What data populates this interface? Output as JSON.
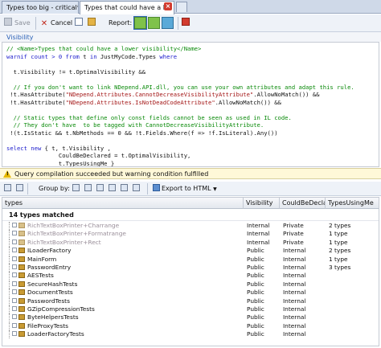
{
  "tabs": [
    {
      "label": "Types too big - critical*",
      "active": false
    },
    {
      "label": "Types that could have a l...",
      "active": true
    }
  ],
  "toolbar": {
    "save_label": "Save",
    "cancel_label": "Cancel",
    "report_label": "Report:"
  },
  "query_name": "Visibility",
  "code_lines": [
    [
      {
        "t": "// <Name>Types that could have a lower visibility</Name>",
        "k": "cm"
      }
    ],
    [
      {
        "t": "warnif count > 0 ",
        "k": "kw"
      },
      {
        "t": "from",
        "k": "kw"
      },
      {
        "t": " t ",
        "k": "tx"
      },
      {
        "t": "in",
        "k": "kw"
      },
      {
        "t": " JustMyCode.Types ",
        "k": "tx"
      },
      {
        "t": "where",
        "k": "kw"
      }
    ],
    [
      {
        "t": "",
        "k": "tx"
      }
    ],
    [
      {
        "t": "  t.Visibility != t.OptimalVisibility &&",
        "k": "tx"
      }
    ],
    [
      {
        "t": "",
        "k": "tx"
      }
    ],
    [
      {
        "t": "  // If you don't want to link NDepend.API.dll, you can use your own attributes and adapt this rule.",
        "k": "cm"
      }
    ],
    [
      {
        "t": " !t.HasAttribute(",
        "k": "tx"
      },
      {
        "t": "\"NDepend.Attributes.CannotDecreaseVisibilityAttribute\"",
        "k": "st"
      },
      {
        "t": ".AllowNoMatch()) &&",
        "k": "tx"
      }
    ],
    [
      {
        "t": " !t.HasAttribute(",
        "k": "tx"
      },
      {
        "t": "\"NDepend.Attributes.IsNotDeadCodeAttribute\"",
        "k": "st"
      },
      {
        "t": ".AllowNoMatch()) &&",
        "k": "tx"
      }
    ],
    [
      {
        "t": "",
        "k": "tx"
      }
    ],
    [
      {
        "t": "  // Static types that define only const fields cannot be seen as used in IL code.",
        "k": "cm"
      }
    ],
    [
      {
        "t": "  // They don't have  to be tagged with CannotDecreaseVisibilityAttribute.",
        "k": "cm"
      }
    ],
    [
      {
        "t": " !(t.IsStatic && t.NbMethods == 0 && !t.Fields.Where(f => !f.IsLiteral).Any())",
        "k": "tx"
      }
    ],
    [
      {
        "t": "",
        "k": "tx"
      }
    ],
    [
      {
        "t": "select new",
        "k": "kw"
      },
      {
        "t": " { t, t.Visibility ,",
        "k": "tx"
      }
    ],
    [
      {
        "t": "               CouldBeDeclared = t.OptimalVisibility,",
        "k": "tx"
      }
    ],
    [
      {
        "t": "               t.TypesUsingMe }",
        "k": "tx"
      }
    ]
  ],
  "status_message": "Query compilation succeeded but warning condition fulfilled",
  "results_toolbar": {
    "group_by_label": "Group by:",
    "export_label": "Export to HTML",
    "export_arrow": "▼"
  },
  "grid": {
    "columns": [
      "types",
      "Visibility",
      "CouldBeDeclarec",
      "TypesUsingMe"
    ],
    "group_label": "14 types matched",
    "rows": [
      {
        "name": "RichTextBoxPrinter+Charrange",
        "visibility": "Internal",
        "could": "Private",
        "using": "2 types",
        "dim": true
      },
      {
        "name": "RichTextBoxPrinter+Formatrange",
        "visibility": "Internal",
        "could": "Private",
        "using": "1 type",
        "dim": true
      },
      {
        "name": "RichTextBoxPrinter+Rect",
        "visibility": "Internal",
        "could": "Private",
        "using": "1 type",
        "dim": true
      },
      {
        "name": "ILoaderFactory",
        "visibility": "Public",
        "could": "Internal",
        "using": "2 types",
        "dim": false
      },
      {
        "name": "MainForm",
        "visibility": "Public",
        "could": "Internal",
        "using": "1 type",
        "dim": false
      },
      {
        "name": "PasswordEntry",
        "visibility": "Public",
        "could": "Internal",
        "using": "3 types",
        "dim": false
      },
      {
        "name": "AESTests",
        "visibility": "Public",
        "could": "Internal",
        "using": "",
        "dim": false
      },
      {
        "name": "SecureHashTests",
        "visibility": "Public",
        "could": "Internal",
        "using": "",
        "dim": false
      },
      {
        "name": "DocumentTests",
        "visibility": "Public",
        "could": "Internal",
        "using": "",
        "dim": false
      },
      {
        "name": "PasswordTests",
        "visibility": "Public",
        "could": "Internal",
        "using": "",
        "dim": false
      },
      {
        "name": "GZipCompressionTests",
        "visibility": "Public",
        "could": "Internal",
        "using": "",
        "dim": false
      },
      {
        "name": "ByteHelpersTests",
        "visibility": "Public",
        "could": "Internal",
        "using": "",
        "dim": false
      },
      {
        "name": "FileProxyTests",
        "visibility": "Public",
        "could": "Internal",
        "using": "",
        "dim": false
      },
      {
        "name": "LoaderFactoryTests",
        "visibility": "Public",
        "could": "Internal",
        "using": "",
        "dim": false
      }
    ]
  },
  "colors": {
    "accent": "#2b61b7",
    "comment": "#0a8a0a",
    "keyword": "#1c1ccc",
    "string": "#a31515",
    "warning_bg": "#fff8d8"
  },
  "icons": [
    "close-icon",
    "new-tab-icon",
    "save-icon",
    "cancel-icon",
    "help-icon",
    "settings-icon",
    "report-icon",
    "warning-icon",
    "group-by-icon",
    "export-icon",
    "class-icon"
  ]
}
